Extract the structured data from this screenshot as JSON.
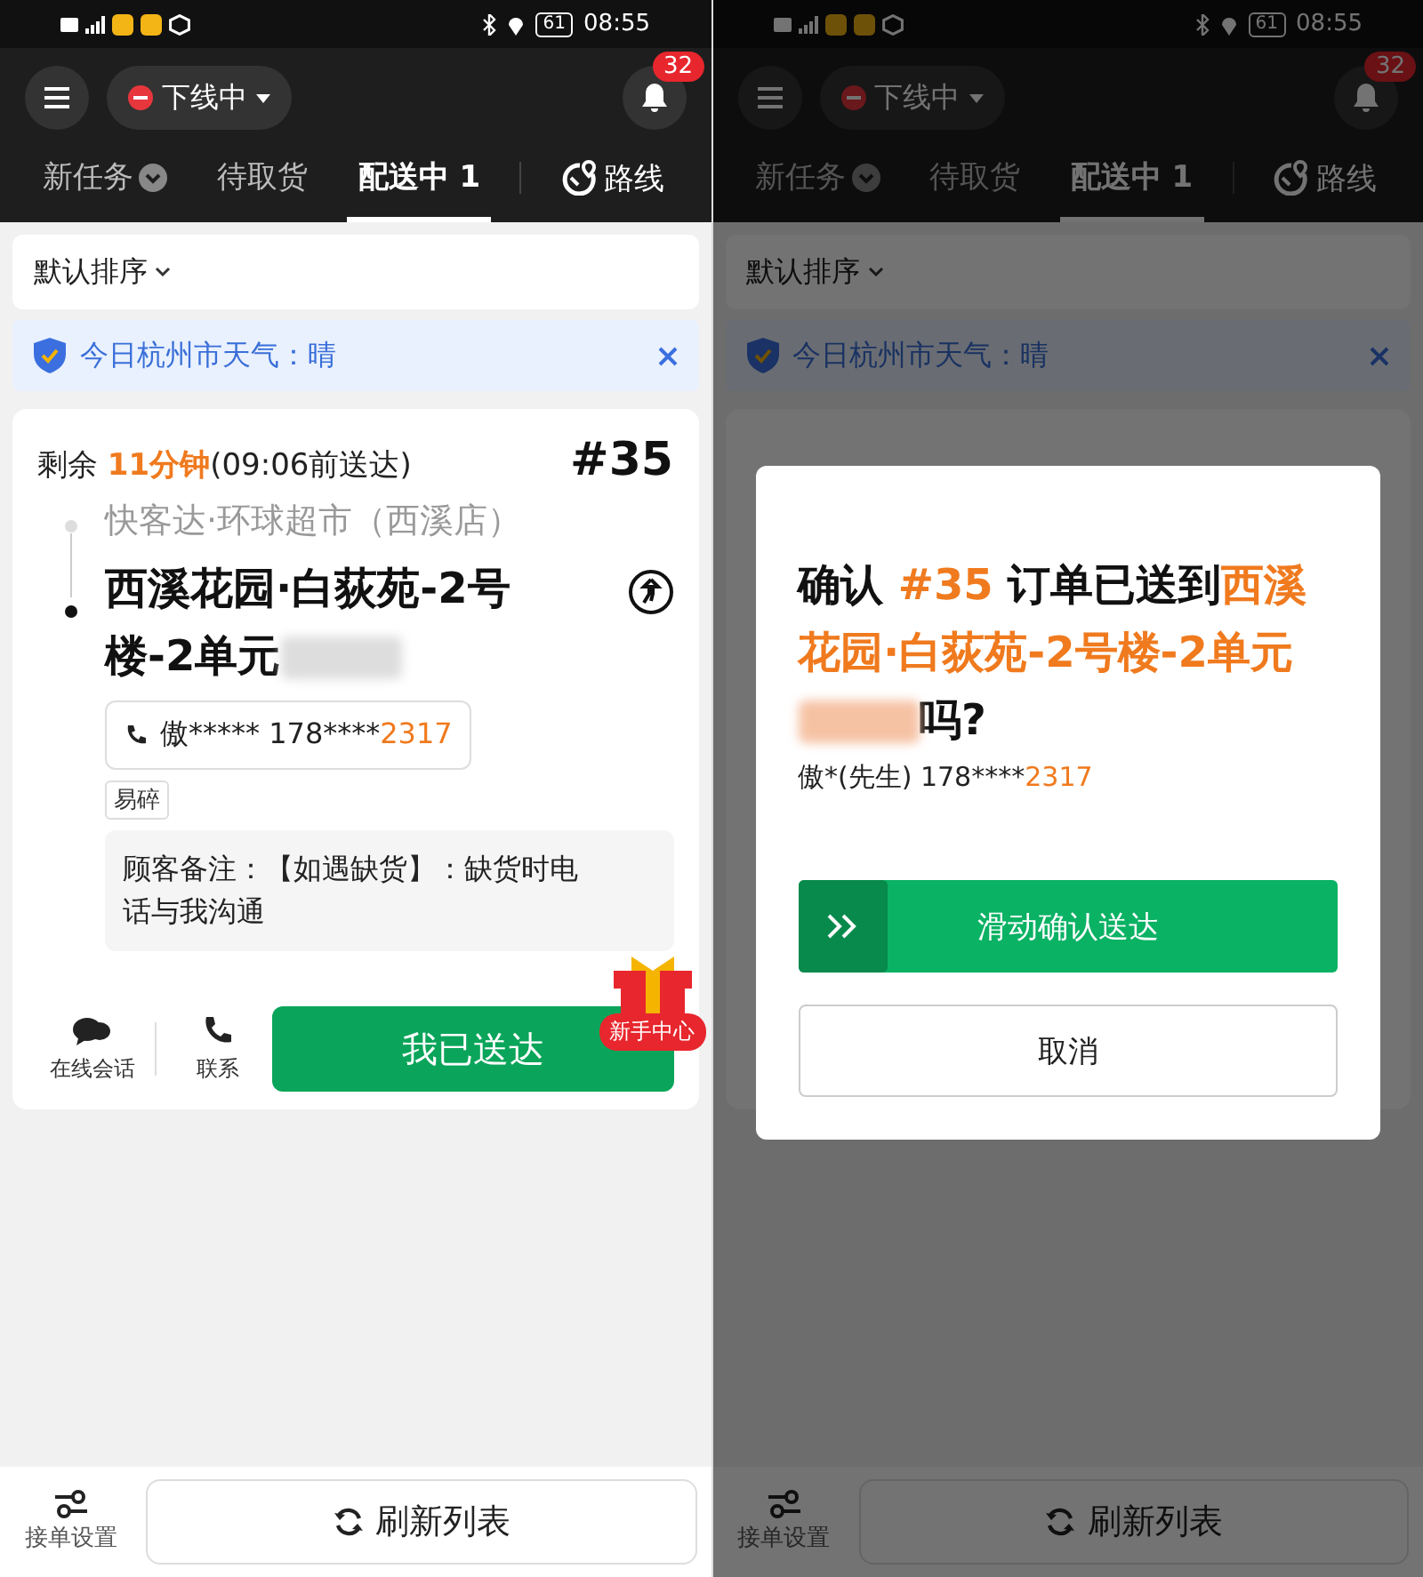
{
  "screens": [
    {
      "status_bar": {
        "time": "08:55",
        "battery": "61"
      },
      "header": {
        "status": "下线中",
        "notification_count": "32"
      },
      "tabs": [
        {
          "label": "新任务",
          "kind": "dropdown",
          "selected": false
        },
        {
          "label": "待取货",
          "kind": "plain",
          "selected": false
        },
        {
          "label": "配送中 1",
          "kind": "plain",
          "selected": true
        }
      ],
      "route": "路线",
      "sort": "默认排序",
      "weather": "今日杭州市天气：晴",
      "order": {
        "remaining_label": "剩余 ",
        "remaining": "11分钟",
        "deadline": "(09:06前送达)",
        "number": "#35",
        "pickup": "快客达·环球超市（西溪店）",
        "address": "西溪花园·白荻苑-2号楼-2单元",
        "phone_masked": "傲***** 178****",
        "phone_tail": "2317",
        "tag": "易碎",
        "note": "顾客备注：【如遇缺货】：缺货时电话与我沟通",
        "chat": "在线会话",
        "contact": "联系",
        "delivered": "我已送达"
      },
      "gift": "新手中心",
      "settings": "接单设置",
      "refresh": "刷新列表"
    },
    {
      "status_bar": {
        "time": "08:55",
        "battery": "61"
      },
      "header": {
        "status": "下线中",
        "notification_count": "32"
      },
      "tabs": [
        {
          "label": "新任务",
          "kind": "dropdown",
          "selected": false
        },
        {
          "label": "待取货",
          "kind": "plain",
          "selected": false
        },
        {
          "label": "配送中 1",
          "kind": "plain",
          "selected": true
        }
      ],
      "route": "路线",
      "sort": "默认排序",
      "weather": "今日杭州市天气：晴",
      "settings": "接单设置",
      "refresh": "刷新列表",
      "dialog": {
        "title_prefix": "确认 ",
        "title_number": "#35",
        "title_middle": " 订单已送到",
        "title_address": "西溪花园·白荻苑-2号楼-2单元",
        "title_suffix": "吗?",
        "customer": "傲*(先生) 178****",
        "customer_tail": "2317",
        "slider": "滑动确认送达",
        "level": 0,
        "cancel": "取消"
      }
    }
  ]
}
